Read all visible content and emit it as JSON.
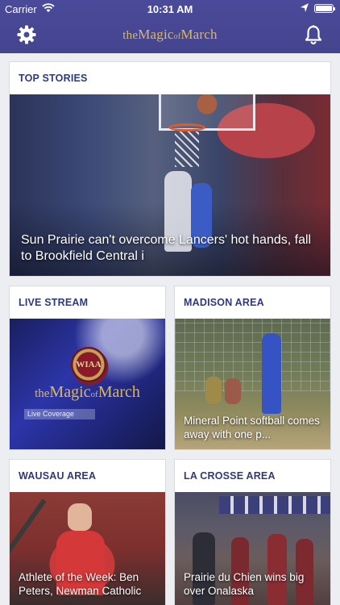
{
  "status_bar": {
    "carrier": "Carrier",
    "time": "10:31 AM"
  },
  "nav": {
    "logo_prefix": "the",
    "logo_main": "Magic",
    "logo_of": "of",
    "logo_end": "March",
    "logo_color": "#d9b76a",
    "bar_color": "#4a4a9a",
    "left_icon": "gear-icon",
    "right_icon": "bell-icon"
  },
  "sections": {
    "top_stories": {
      "title": "TOP STORIES",
      "caption": "Sun Prairie can't overcome Lancers' hot hands, fall to Brookfield Central i"
    },
    "live_stream": {
      "title": "LIVE STREAM",
      "logo_prefix": "the",
      "logo_main": "Magic",
      "logo_of": "of",
      "logo_end": "March",
      "medallion": "WIAA",
      "tag": "Live Coverage"
    },
    "madison_area": {
      "title": "MADISON AREA",
      "caption": "Mineral Point softball comes away with one p..."
    },
    "wausau_area": {
      "title": "WAUSAU AREA",
      "caption": "Athlete of the Week: Ben Peters, Newman Catholic"
    },
    "la_crosse_area": {
      "title": "LA CROSSE AREA",
      "caption": "Prairie du Chien wins big over Onalaska"
    }
  },
  "colors": {
    "section_title": "#2f3a7a",
    "background": "#eceef2"
  }
}
